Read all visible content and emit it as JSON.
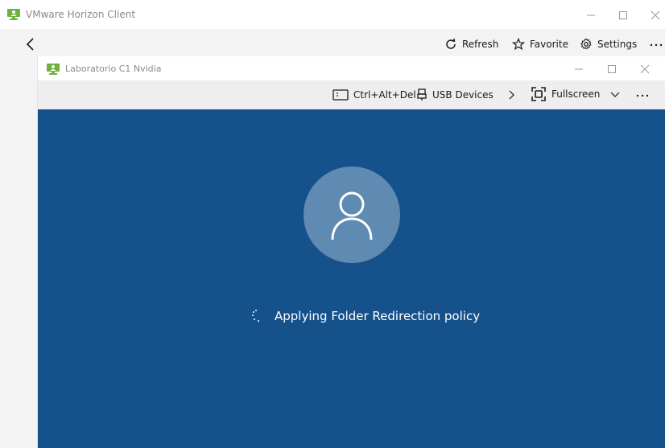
{
  "outer_window": {
    "title": "VMware Horizon Client",
    "toolbar": {
      "refresh_label": "Refresh",
      "favorite_label": "Favorite",
      "settings_label": "Settings"
    }
  },
  "inner_window": {
    "title": "Laboratorio C1 Nvidia",
    "toolbar": {
      "ctrl_alt_del_label": "Ctrl+Alt+Del",
      "usb_devices_label": "USB Devices",
      "fullscreen_label": "Fullscreen"
    }
  },
  "desktop": {
    "status_text": "Applying Folder Redirection policy"
  },
  "colors": {
    "desktop_bg": "#15518b",
    "avatar_bg": "#5f8ab2",
    "app_icon_green": "#6cb33f"
  },
  "icons": [
    "horizon-app-icon",
    "minimize-icon",
    "maximize-icon",
    "close-icon",
    "back-arrow-icon",
    "refresh-icon",
    "star-icon",
    "gear-icon",
    "more-icon",
    "keyboard-icon",
    "usb-icon",
    "chevron-right-icon",
    "fullscreen-icon",
    "chevron-down-icon",
    "user-icon",
    "spinner-icon"
  ]
}
